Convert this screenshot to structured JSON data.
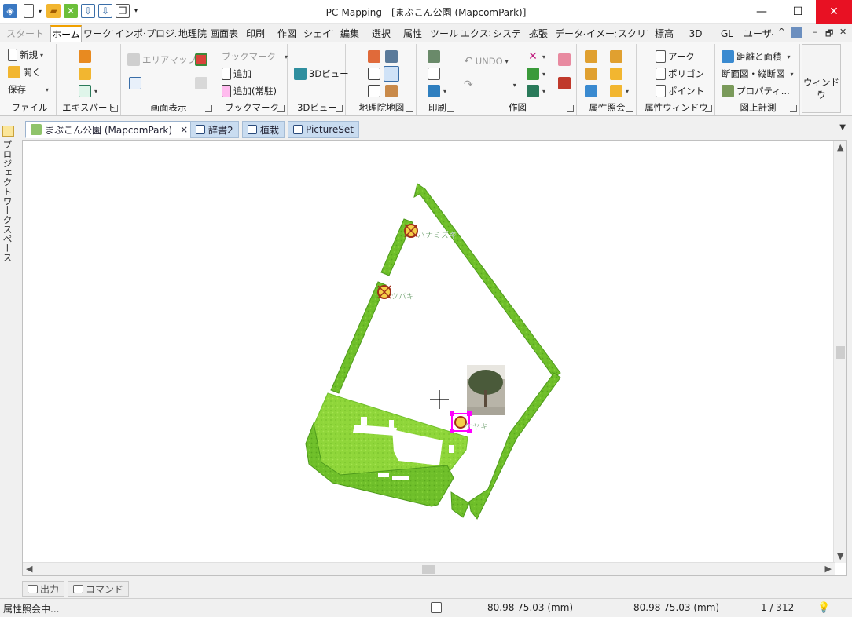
{
  "window": {
    "title": "PC-Mapping - [まぶこん公園 (MapcomPark)]",
    "minimize": "—",
    "maximize": "☐",
    "close": "✕"
  },
  "quick_access": [
    "app-icon",
    "new-icon",
    "open-icon",
    "grid-icon",
    "import-icon",
    "export-icon",
    "copy-icon",
    "customize-icon"
  ],
  "ribbon_tabs": [
    "スタート",
    "ホーム",
    "ワークフ",
    "インポー",
    "プロジュ",
    "地理院",
    "画面表",
    "印刷",
    "作図",
    "シェイフ",
    "編集",
    "選択",
    "属性",
    "ツール",
    "エクスポ",
    "システ",
    "拡張",
    "データヘ",
    "イメージ",
    "スクリフ",
    "標高",
    "3D",
    "GL",
    "ユーザ-"
  ],
  "ribbon_controls": {
    "collapse": "^",
    "minimize": "–",
    "restore": "🗗",
    "close": "✕"
  },
  "groups": {
    "file": {
      "label": "ファイル",
      "new": "新規",
      "open": "開く",
      "save": "保存"
    },
    "expert": {
      "label": "エキスパート"
    },
    "display": {
      "label": "画面表示",
      "area_map": "エリアマップ"
    },
    "bookmark": {
      "label": "ブックマーク",
      "bookmark": "ブックマーク",
      "add": "追加",
      "add_resident": "追加(常駐)"
    },
    "view3d": {
      "label": "3Dビュー",
      "view": "3Dビュー"
    },
    "gsi": {
      "label": "地理院地図"
    },
    "print": {
      "label": "印刷"
    },
    "draw": {
      "label": "作図",
      "undo": "UNDO"
    },
    "attr_query": {
      "label": "属性照会"
    },
    "attr_window": {
      "label": "属性ウィンドウ",
      "arc": "アーク",
      "polygon": "ポリゴン",
      "point": "ポイント"
    },
    "measure": {
      "label": "図上計測",
      "distance_area": "距離と面積",
      "section": "断面図・縦断図",
      "property": "プロパティ..."
    },
    "window": {
      "label": "ウィンドウ"
    }
  },
  "doc_tabs": [
    {
      "label": "まぶこん公園 (MapcomPark)",
      "close": "×"
    },
    {
      "label": "辞書2"
    },
    {
      "label": "植栽"
    },
    {
      "label": "PictureSet"
    }
  ],
  "side_pane": {
    "label": "プロジェクトワークスペース"
  },
  "map": {
    "labels": [
      "ハナミズキ",
      "ツバキ",
      "ケヤキ"
    ],
    "colors": {
      "green": "#6fbf2a",
      "dark_green": "#4e9a1c",
      "light_green": "#8fd63a",
      "selection": "#ff00ff"
    }
  },
  "bottom_tabs": [
    "出力",
    "コマンド"
  ],
  "status": {
    "message": "属性照会中...",
    "coord1": "80.98 75.03 (mm)",
    "coord2": "80.98 75.03 (mm)",
    "page": "1 / 312"
  }
}
